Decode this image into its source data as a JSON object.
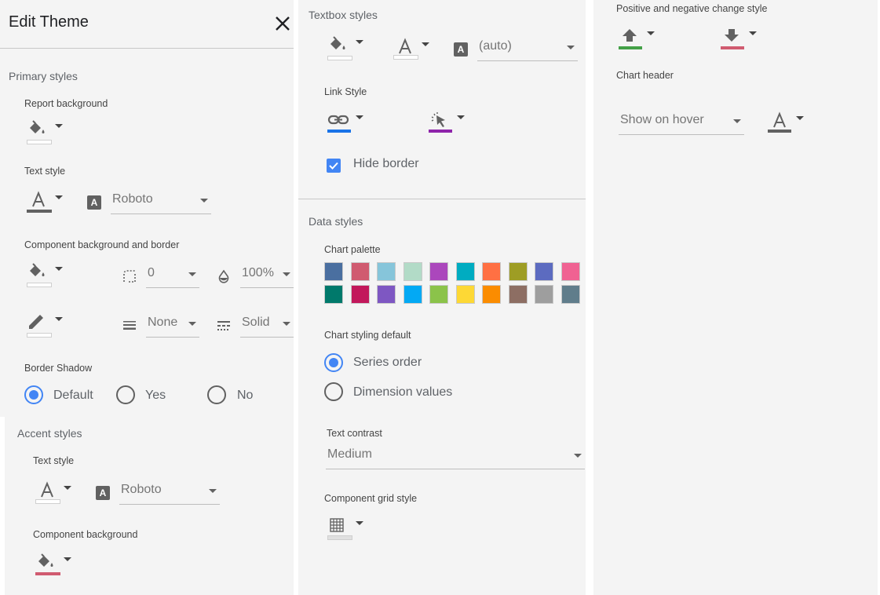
{
  "title": "Edit Theme",
  "primary": {
    "label": "Primary styles",
    "report_background": "Report background",
    "text_style": "Text style",
    "text_font": "Roboto",
    "component_bg_border": "Component background and border",
    "border_radius": "0",
    "opacity": "100%",
    "border_weight": "None",
    "border_style": "Solid",
    "border_shadow": "Border Shadow",
    "shadow_options": [
      "Default",
      "Yes",
      "No"
    ],
    "shadow_selected": "Default"
  },
  "accent": {
    "label": "Accent styles",
    "text_style": "Text style",
    "text_font": "Roboto",
    "component_bg": "Component background",
    "bg_color": "#d05b70"
  },
  "textbox": {
    "label": "Textbox styles",
    "font": "(auto)",
    "link_style": "Link Style",
    "link_color": "#1a73e8",
    "link_hover_color": "#8e24aa",
    "hide_border": "Hide border",
    "hide_border_checked": true
  },
  "data": {
    "label": "Data styles",
    "chart_palette": "Chart palette",
    "palette": [
      "#4a6fa0",
      "#d05b70",
      "#86c5da",
      "#b2dbc7",
      "#ab47bc",
      "#00acc1",
      "#ff7043",
      "#9e9d24",
      "#5c6bc0",
      "#f06292",
      "#00796b",
      "#c2185b",
      "#7e57c2",
      "#03a9f4",
      "#8bc34a",
      "#fdd835",
      "#fb8c00",
      "#8d6e63",
      "#9e9e9e",
      "#607d8b"
    ],
    "chart_styling_default": "Chart styling default",
    "styling_options": [
      "Series order",
      "Dimension values"
    ],
    "styling_selected": "Series order",
    "text_contrast": "Text contrast",
    "text_contrast_value": "Medium",
    "grid_style": "Component grid style"
  },
  "change": {
    "label": "Positive and negative change style",
    "positive_color": "#43a047",
    "negative_color": "#d05b70",
    "chart_header": "Chart header",
    "chart_header_value": "Show on hover"
  }
}
